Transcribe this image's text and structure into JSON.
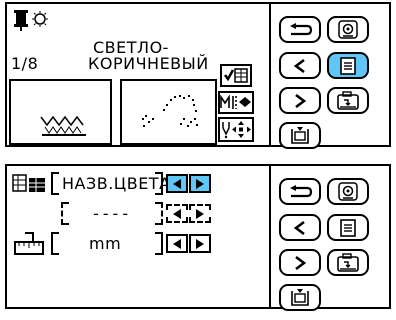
{
  "top_panel": {
    "position": "1/8",
    "color_name_line1": "СВЕТЛО-",
    "color_name_line2": "КОРИЧНЕВЫЙ"
  },
  "bottom_panel": {
    "row1_label": "НАЗВ.ЦВЕТА",
    "row2_value": "----",
    "row3_unit": "mm"
  },
  "nav_buttons": [
    {
      "icon": "back-icon",
      "selected": false
    },
    {
      "icon": "embroidery-foot-icon",
      "selected": false
    },
    {
      "icon": "prev-icon",
      "selected": false
    },
    {
      "icon": "page-icon",
      "selected": true
    },
    {
      "icon": "next-icon",
      "selected": false
    },
    {
      "icon": "camera-icon",
      "selected": false
    },
    {
      "icon": "hoop-icon",
      "selected": false
    }
  ],
  "colors": {
    "accent": "#5fc6f5",
    "border": "#000000",
    "background": "#ffffff"
  }
}
